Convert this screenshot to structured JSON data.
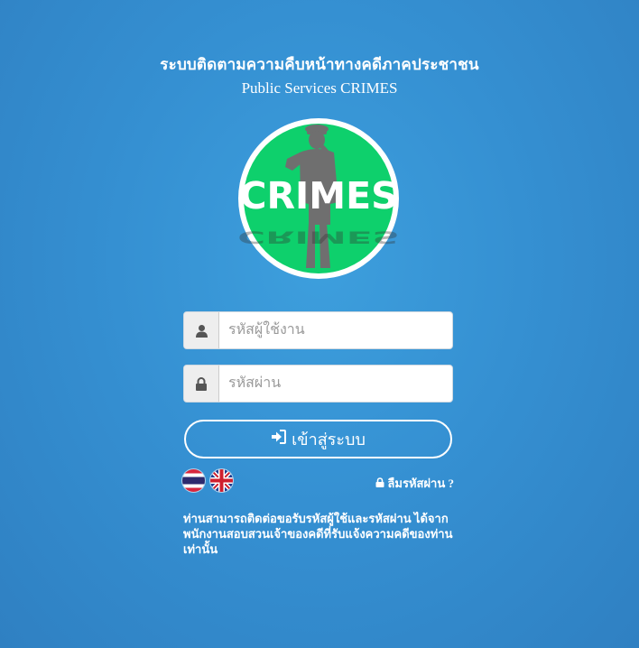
{
  "header": {
    "title_th": "ระบบติดตามความคืบหน้าทางคดีภาคประชาชน",
    "title_en": "Public Services CRIMES"
  },
  "logo": {
    "text": "CRIMES",
    "bg_color": "#0ed06c"
  },
  "form": {
    "username_placeholder": "รหัสผู้ใช้งาน",
    "username_value": "",
    "password_placeholder": "รหัสผ่าน",
    "password_value": "",
    "login_label": "เข้าสู่ระบบ"
  },
  "language": {
    "options": [
      "th",
      "en"
    ]
  },
  "forgot_password": "ลืมรหัสผ่าน ?",
  "note": "ท่านสามารถติดต่อขอรับรหัสผู้ใช้และรหัสผ่าน ได้จากพนักงานสอบสวนเจ้าของคดีที่รับแจ้งความคดีของท่านเท่านั้น",
  "icons": {
    "user": "user-icon",
    "lock": "lock-icon",
    "login": "sign-in-icon",
    "forgot_lock": "lock-icon"
  }
}
